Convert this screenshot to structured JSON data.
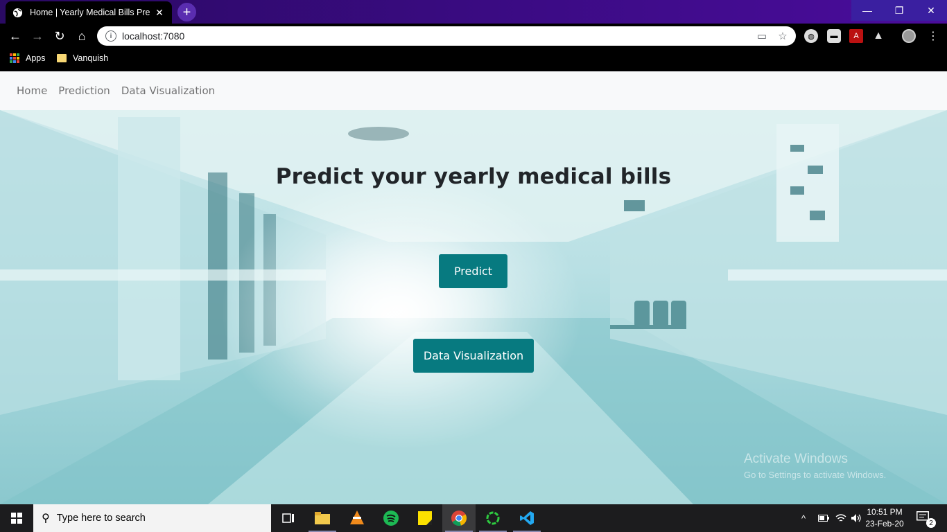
{
  "browser": {
    "tab_title": "Home | Yearly Medical Bills Predic",
    "tab_close": "✕",
    "new_tab": "+",
    "window_controls": {
      "minimize": "—",
      "maximize": "❐",
      "close": "✕"
    },
    "nav": {
      "back": "←",
      "forward": "→",
      "reload": "↻",
      "home": "⌂"
    },
    "url": "localhost:7080",
    "info": "i",
    "omnibox_icons": [
      "cast-icon",
      "star-icon"
    ],
    "extensions": [
      "globe-icon",
      "chat-icon",
      "pdf-icon",
      "drive-icon",
      "profile-avatar"
    ]
  },
  "bookmarks": {
    "apps_label": "Apps",
    "folder_label": "Vanquish"
  },
  "navbar": {
    "items": [
      "Home",
      "Prediction",
      "Data Visualization"
    ]
  },
  "hero": {
    "title": "Predict your yearly medical bills",
    "predict_button": "Predict",
    "dataviz_button": "Data Visualization"
  },
  "watermark": {
    "line1": "Activate Windows",
    "line2": "Go to Settings to activate Windows."
  },
  "taskbar": {
    "search_placeholder": "Type here to search",
    "apps": [
      "task-view-icon",
      "file-explorer-icon",
      "vlc-icon",
      "spotify-icon",
      "sticky-notes-icon",
      "chrome-icon",
      "app-ring-icon",
      "vscode-icon"
    ],
    "time": "10:51 PM",
    "date": "23-Feb-20",
    "notification_count": "2"
  },
  "colors": {
    "accent_button": "#077a80",
    "title_bar": "#3b0b84",
    "navbar_bg": "#f8f9fa"
  }
}
